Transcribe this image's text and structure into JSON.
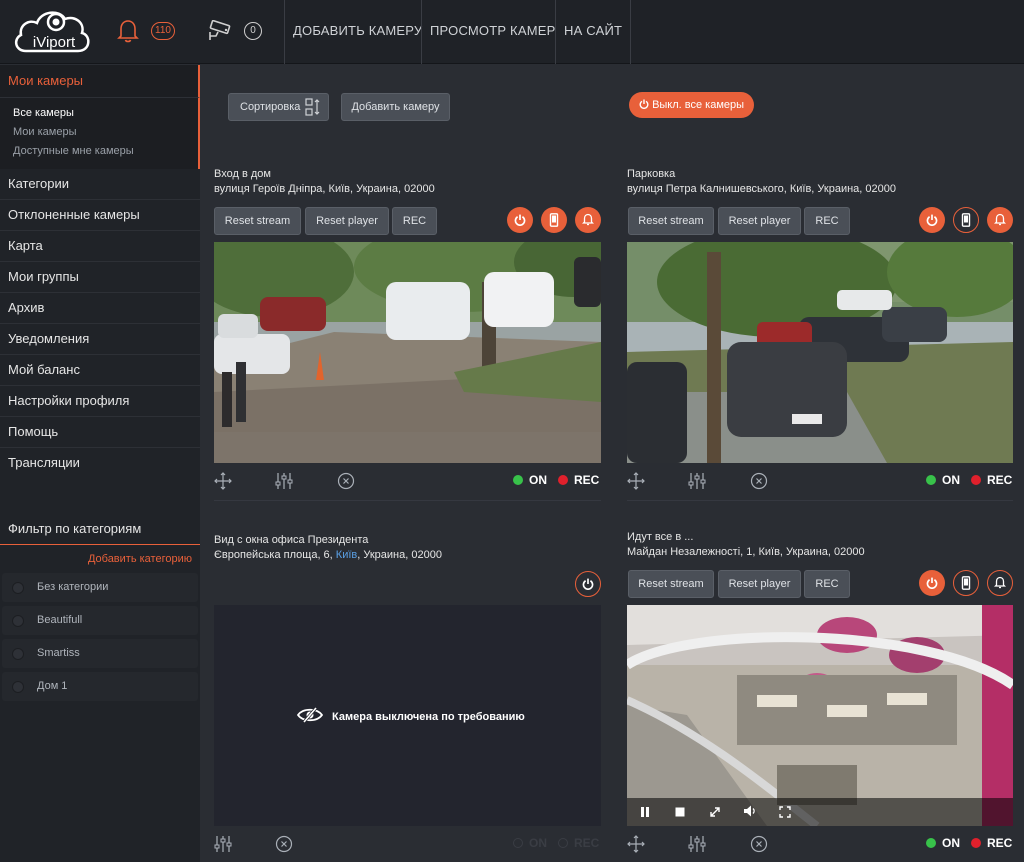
{
  "header": {
    "logo_text": "iViport",
    "notifications_count": "110",
    "cameras_count": "0",
    "nav": [
      "ДОБАВИТЬ КАМЕРУ",
      "ПРОСМОТР КАМЕР",
      "НА САЙТ"
    ]
  },
  "sidebar": {
    "active_section": "Мои камеры",
    "sub_items": [
      "Все камеры",
      "Мои камеры",
      "Доступные мне камеры"
    ],
    "items": [
      "Категории",
      "Отклоненные камеры",
      "Карта",
      "Мои группы",
      "Архив",
      "Уведомления",
      "Мой баланс",
      "Настройки профиля",
      "Помощь",
      "Трансляции"
    ],
    "filter_title": "Фильтр по категориям",
    "add_category": "Добавить категорию",
    "categories": [
      "Без категории",
      "Beautifull",
      "Smartiss",
      "Дом 1"
    ]
  },
  "toolbar": {
    "sort_label": "Сортировка",
    "add_camera_label": "Добавить камеру",
    "disable_all_label": "Выкл. все камеры"
  },
  "controls": {
    "reset_stream": "Reset stream",
    "reset_player": "Reset player",
    "rec": "REC",
    "on": "ON",
    "rec_status": "REC"
  },
  "cameras": [
    {
      "name": "Вход в дом",
      "address": "вулиця Героїв Дніпра, Київ, Украина, 02000"
    },
    {
      "name": "Парковка",
      "address": "вулиця Петра Калнишевського, Київ, Украина, 02000"
    },
    {
      "name": "Вид с окна офиса Президента",
      "address_prefix": "Європейська площа, 6, ",
      "address_city": "Київ",
      "address_suffix": ", Украина, 02000",
      "off_message": "Камера выключена по требованию"
    },
    {
      "name": "Идут все в ...",
      "address": "Майдан Незалежності, 1, Київ, Украина, 02000"
    }
  ],
  "colors": {
    "accent": "#e8603a",
    "on": "#38c24a",
    "rec": "#e0202c"
  }
}
